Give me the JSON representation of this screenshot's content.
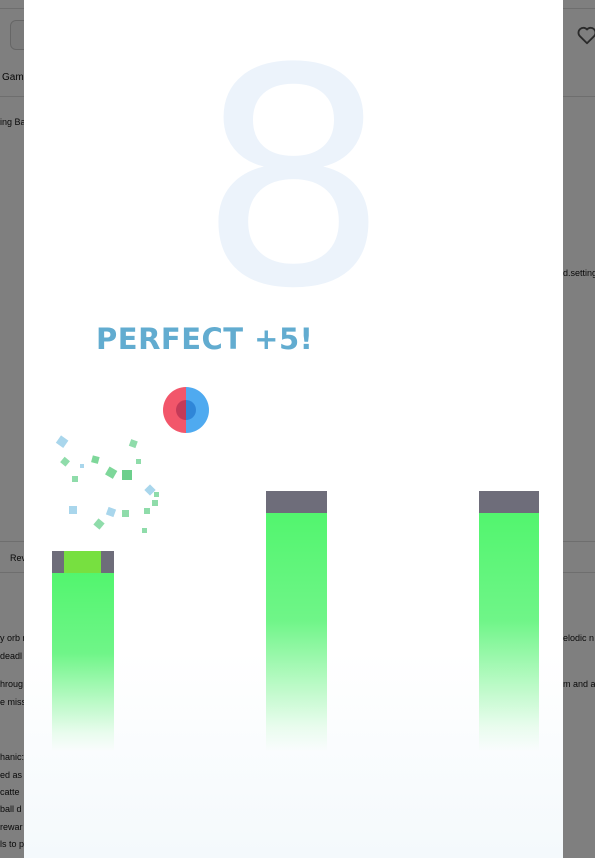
{
  "background_page": {
    "nav_fragment": "Game",
    "breadcrumb_fragment": "ing Ba",
    "tab_fragment": "Rev",
    "right_link_fragment": "d.setting",
    "desc_fragments_left": [
      "y orb n",
      "deadl",
      "hroug",
      "e miss",
      "hanic:",
      "ed as",
      "catte",
      "ball d",
      "rewar",
      "ls to p"
    ],
    "desc_fragments_right": [
      "elodic n",
      "m and a"
    ]
  },
  "game": {
    "score": "8",
    "feedback_text": "PERFECT +5!",
    "colors": {
      "score": "#ecf3fb",
      "feedback": "#62acd0",
      "ball_left": "#f2566a",
      "ball_right": "#4faaf0",
      "pillar_cap": "#6e6d7a",
      "pillar_body": "#52f56e",
      "target_zone": "#77e040"
    },
    "pillar_count": 3,
    "ball_icon": "split-orb"
  }
}
